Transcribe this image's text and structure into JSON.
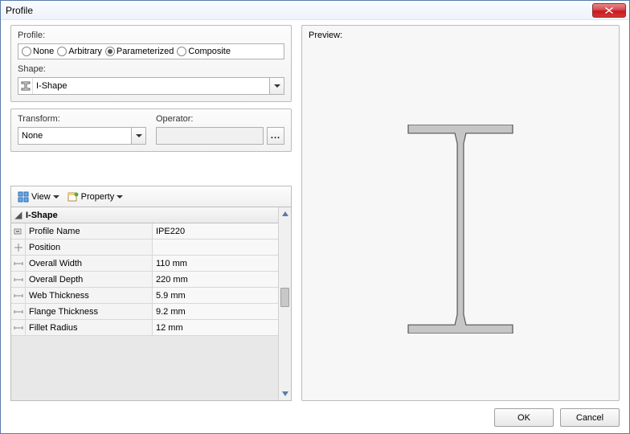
{
  "window": {
    "title": "Profile"
  },
  "profileGroup": {
    "label": "Profile:",
    "options": {
      "none": "None",
      "arbitrary": "Arbitrary",
      "parameterized": "Parameterized",
      "composite": "Composite"
    },
    "shapeLabel": "Shape:",
    "shapeValue": "I-Shape"
  },
  "transformGroup": {
    "transformLabel": "Transform:",
    "transformValue": "None",
    "operatorLabel": "Operator:",
    "operatorValue": ""
  },
  "toolbar": {
    "view": "View",
    "property": "Property"
  },
  "grid": {
    "header": "I-Shape",
    "rows": [
      {
        "label": "Profile Name",
        "value": "IPE220",
        "icon": "tag"
      },
      {
        "label": "Position",
        "value": "",
        "icon": "pos"
      },
      {
        "label": "Overall Width",
        "value": "110 mm",
        "icon": "dim"
      },
      {
        "label": "Overall Depth",
        "value": "220 mm",
        "icon": "dim"
      },
      {
        "label": "Web Thickness",
        "value": "5.9 mm",
        "icon": "dim"
      },
      {
        "label": "Flange Thickness",
        "value": "9.2 mm",
        "icon": "dim"
      },
      {
        "label": "Fillet Radius",
        "value": "12 mm",
        "icon": "dim"
      }
    ]
  },
  "preview": {
    "label": "Preview:"
  },
  "footer": {
    "ok": "OK",
    "cancel": "Cancel"
  }
}
